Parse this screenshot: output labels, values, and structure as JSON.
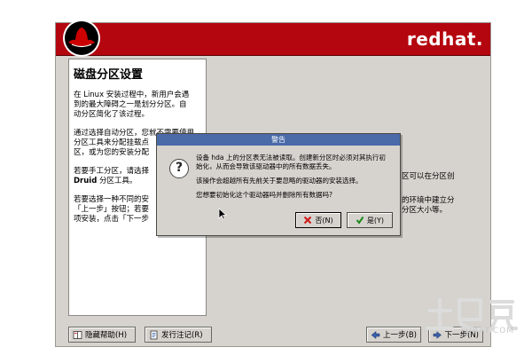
{
  "header": {
    "brand": "redhat."
  },
  "help": {
    "title": "磁盘分区设置",
    "para1": "在 Linux 安装过程中，新用户会遇\n到的最大障碍之一是划分分区。自\n动分区简化了该过程。",
    "para2": "通过选择自动分区，您就不需要使用\n分区工具来分配挂载点\n区，或为您的安装分配",
    "para3_prefix": "若要手工分区，请选择\n",
    "para3_druid": "Druid",
    "para3_suffix": " 分区工具。",
    "para4": "若要选择一种不同的安\n「上一步」按钮；若要\n项安装，点击「下一步"
  },
  "right_snippets": {
    "line1": "区可以在分区创",
    "line2": "的环境中建立分\n分区大小等。"
  },
  "buttons": {
    "hide_help": "隐藏帮助(H)",
    "release_notes": "发行注记(R)",
    "back": "上一步(B)",
    "next": "下一步(N)"
  },
  "dialog": {
    "title": "警告",
    "message1": "设备 hda 上的分区表无法被读取。创建新分区时必须对其执行初\n始化，从而会导致该驱动器中的所有数据丢失。",
    "message2": "该操作会超越所有先前关于要忽略的驱动器的安装选择。",
    "message3": "您想要初始化这个驱动器吗并删除所有数据吗?",
    "no_label": "否(N)",
    "yes_label": "是(Y)"
  },
  "watermark": {
    "text": "TUBAT.COM"
  },
  "colors": {
    "banner": "#b4060f",
    "dialog_titlebar": "#4a6aa8",
    "window_bg": "#d6d3ce"
  },
  "icons": {
    "dialog": "question-icon",
    "no": "red-x-icon",
    "yes": "green-check-icon",
    "hide_help": "help-book-icon",
    "release_notes": "notes-icon",
    "back": "left-arrow-icon",
    "next": "right-arrow-icon"
  }
}
